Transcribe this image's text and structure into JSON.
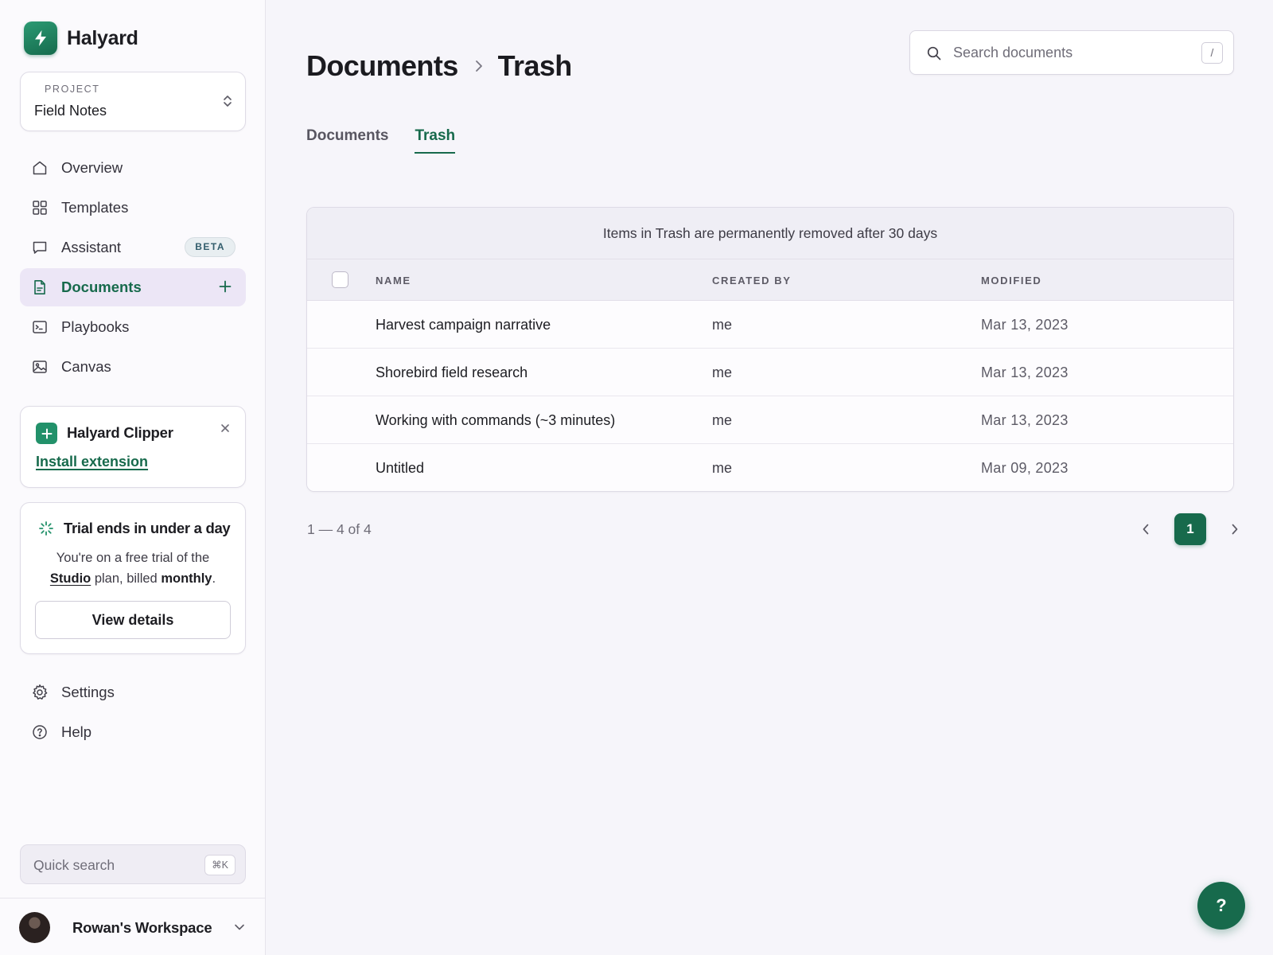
{
  "brand": {
    "name": "Halyard",
    "logo_icon": "bolt-icon",
    "accent": "#176a4c"
  },
  "project": {
    "label": "PROJECT",
    "value": "Field Notes"
  },
  "nav": [
    {
      "label": "Overview",
      "icon": "home-icon"
    },
    {
      "label": "Templates",
      "icon": "grid-icon"
    },
    {
      "label": "Assistant",
      "icon": "chat-icon",
      "badge": "BETA"
    },
    {
      "label": "Documents",
      "icon": "document-icon",
      "active": true
    },
    {
      "label": "Playbooks",
      "icon": "terminal-icon"
    },
    {
      "label": "Canvas",
      "icon": "image-icon"
    }
  ],
  "clipper": {
    "title": "Halyard Clipper",
    "link": "Install extension"
  },
  "trial": {
    "title": "Trial ends in under a day",
    "text_1": "You're on a free trial of the",
    "plan": "Studio",
    "text_2": "plan, billed",
    "billing": "monthly",
    "text_3": ".",
    "button": "View details"
  },
  "nav_bottom": [
    {
      "label": "Settings",
      "icon": "gear-icon"
    },
    {
      "label": "Help",
      "icon": "help-circle-icon"
    }
  ],
  "quick_search": {
    "label": "Quick search",
    "shortcut": "⌘K"
  },
  "workspace": {
    "name": "Rowan's Workspace"
  },
  "header": {
    "breadcrumb": [
      "Documents",
      "Trash"
    ],
    "search_placeholder": "Search documents",
    "search_shortcut": "/"
  },
  "tabs": [
    {
      "label": "Documents",
      "active": false
    },
    {
      "label": "Trash",
      "active": true
    }
  ],
  "table": {
    "notice": "Items in Trash are permanently removed after 30 days",
    "columns": [
      "NAME",
      "CREATED BY",
      "MODIFIED"
    ],
    "rows": [
      {
        "name": "Harvest campaign narrative",
        "created_by": "me",
        "modified": "Mar 13, 2023"
      },
      {
        "name": "Shorebird field research",
        "created_by": "me",
        "modified": "Mar 13, 2023"
      },
      {
        "name": "Working with commands (~3 minutes)",
        "created_by": "me",
        "modified": "Mar 13, 2023"
      },
      {
        "name": "Untitled",
        "created_by": "me",
        "modified": "Mar 09, 2023"
      }
    ]
  },
  "pagination": {
    "range": "1 — 4 of 4",
    "current_page": "1"
  },
  "help_fab": {
    "label": "?"
  }
}
